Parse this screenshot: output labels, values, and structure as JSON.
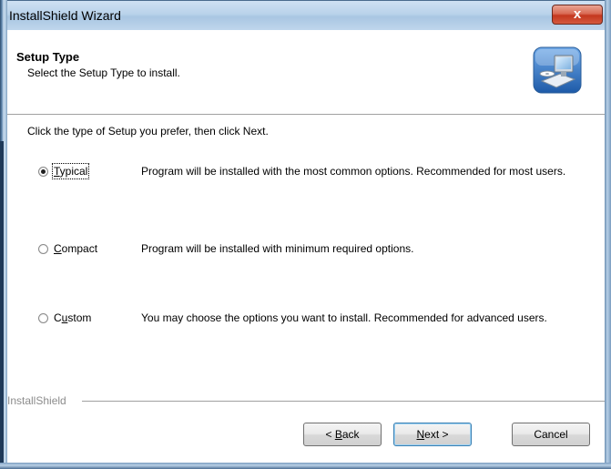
{
  "window": {
    "title": "InstallShield Wizard",
    "close_glyph": "x"
  },
  "header": {
    "title": "Setup Type",
    "subtitle": "Select the Setup Type to install.",
    "icon": "installer-computer-icon"
  },
  "instruction": "Click the type of Setup you prefer, then click Next.",
  "options": [
    {
      "label_pre": "",
      "label_ul": "T",
      "label_post": "ypical",
      "selected": true,
      "description": "Program will be installed with the most common options.  Recommended for most users."
    },
    {
      "label_pre": "",
      "label_ul": "C",
      "label_post": "ompact",
      "selected": false,
      "description": "Program will be installed with minimum required options."
    },
    {
      "label_pre": "C",
      "label_ul": "u",
      "label_post": "stom",
      "selected": false,
      "description": "You may choose the options you want to install. Recommended for advanced users."
    }
  ],
  "brand": "InstallShield",
  "buttons": {
    "back": {
      "pre": "< ",
      "ul": "B",
      "post": "ack"
    },
    "next": {
      "pre": "",
      "ul": "N",
      "post": "ext >"
    },
    "cancel": "Cancel"
  },
  "colors": {
    "title_bar": "#b9d2ea",
    "close_button": "#c4371e",
    "default_button_border": "#3c7fb1"
  }
}
